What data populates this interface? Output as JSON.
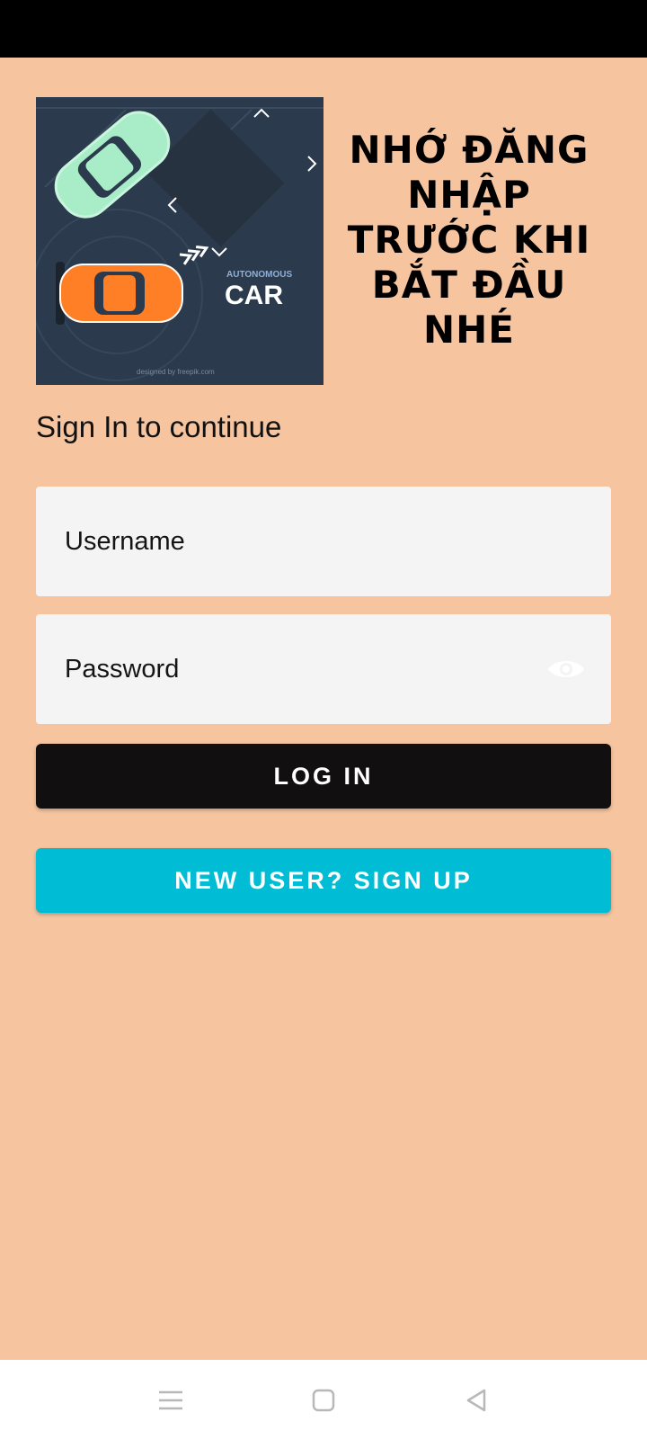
{
  "header": {
    "headline": "NHỚ ĐĂNG NHẬP TRƯỚC KHI BẮT ĐẦU NHÉ"
  },
  "logo": {
    "brand_small": "AUTONOMOUS",
    "brand_big": "CAR",
    "credit": "designed by freepik.com"
  },
  "form": {
    "subtitle": "Sign In to continue",
    "username_placeholder": "Username",
    "password_placeholder": "Password",
    "login_label": "LOG IN",
    "signup_label": "NEW USER? SIGN UP"
  },
  "colors": {
    "background": "#f6c5a0",
    "login_button": "#110f10",
    "signup_button": "#00bcd4",
    "field_background": "#f4f4f4"
  },
  "icons": {
    "password_toggle": "eye-icon",
    "nav": [
      "menu-icon",
      "home-icon",
      "back-icon"
    ]
  }
}
